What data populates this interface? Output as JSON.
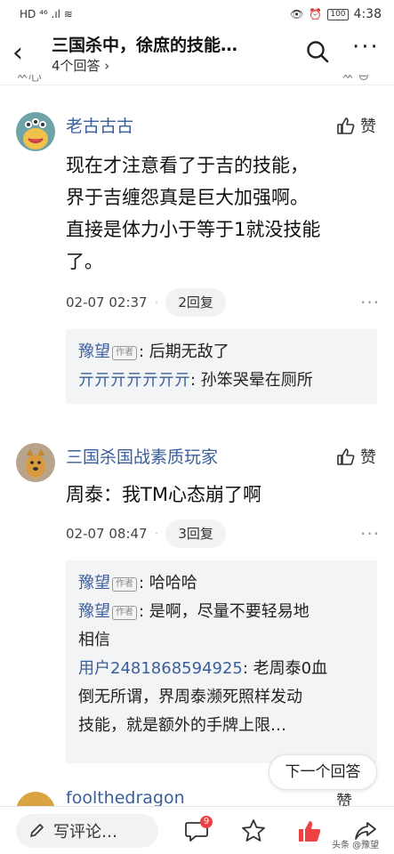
{
  "status": {
    "left": "HD ⁴⁶ .ıl ≋",
    "battery": "100",
    "time": "4:38"
  },
  "nav": {
    "title": "三国杀中，徐庶的技能…",
    "subtitle": "4个回答 ›"
  },
  "clipped_top": {
    "left": "ㅆ心",
    "right": "ㅆ ⊖"
  },
  "comments": [
    {
      "author": "老古古古",
      "like_label": "赞",
      "content": [
        "现在才注意看了于吉的技能，",
        "界于吉缠怨真是巨大加强啊。",
        "直接是体力小于等于1就没技能",
        "了。"
      ],
      "time": "02-07 02:37",
      "replies_label": "2回复",
      "replies": [
        {
          "name": "豫望",
          "tag": "作者",
          "text": ": 后期无敌了"
        },
        {
          "name": "亓亓亓亓亓亓亓",
          "tag": "",
          "text": ": 孙笨哭晕在厕所"
        }
      ]
    },
    {
      "author": "三国杀国战素质玩家",
      "like_label": "赞",
      "content": [
        "周泰：我TM心态崩了啊"
      ],
      "time": "02-07 08:47",
      "replies_label": "3回复",
      "replies": [
        {
          "name": "豫望",
          "tag": "作者",
          "text": ": 哈哈哈"
        },
        {
          "name": "豫望",
          "tag": "作者",
          "text": ": 是啊，尽量不要轻易地",
          "text2": "相信"
        },
        {
          "name": "用户2481868594925",
          "tag": "",
          "text": ": 老周泰0血",
          "text2": "倒无所谓，界周泰濒死照样发动",
          "text3": "技能，就是额外的手牌上限…"
        }
      ]
    }
  ],
  "partial_comment": {
    "author": "foolthedragon",
    "like_label": "赞"
  },
  "next_answer_label": "下一个回答",
  "bottom": {
    "write_label": "写评论…",
    "comment_badge": "9",
    "watermark": "头条 @豫望"
  },
  "colors": {
    "link": "#3a5f9b",
    "badge": "#f04142",
    "like_active": "#f04142"
  }
}
